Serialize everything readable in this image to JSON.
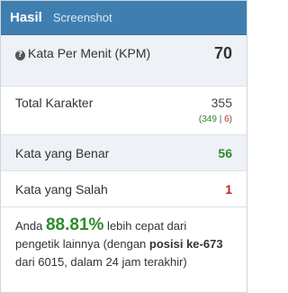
{
  "header": {
    "title": "Hasil",
    "tab": "Screenshot"
  },
  "stats": {
    "kpm": {
      "label": "Kata Per Menit (KPM)",
      "value": "70",
      "help_icon": "question-mark-icon"
    },
    "total": {
      "label": "Total Karakter",
      "value": "355",
      "breakdown_open": "(",
      "correct": "349",
      "separator": " | ",
      "wrong": "6",
      "breakdown_close": ")"
    },
    "benar": {
      "label": "Kata yang Benar",
      "value": "56"
    },
    "salah": {
      "label": "Kata yang Salah",
      "value": "1"
    }
  },
  "summary": {
    "prefix": "Anda ",
    "percent": "88.81%",
    "middle": " lebih cepat dari pengetik lainnya (dengan ",
    "rank": "posisi ke-673",
    "suffix": " dari 6015, dalam 24 jam terakhir)"
  },
  "colors": {
    "header_bg": "#3f7fb0",
    "correct": "#2e8b2e",
    "wrong": "#cc1f1f",
    "row_alt": "#eef1f5"
  }
}
